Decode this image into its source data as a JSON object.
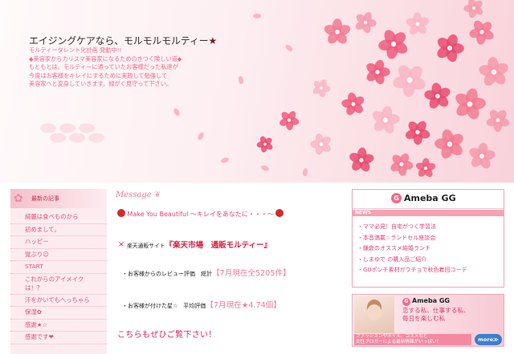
{
  "header": {
    "title": "エイジングケアなら、モルモルモルティー",
    "title_star": "★",
    "description": "モルティータレント化計画 発動中!!\n◆美容家からカリスマ美容家になるためのきつく険しい道◆\nもともとは、モルティーに通っていたお客様だった私達が\n今度はお客様をキレイにするために実践して勉強して\n美容家へと変身していきます。緑がく見守って下さい。"
  },
  "sidebar": {
    "title": "最新の記事",
    "items": [
      "綺麗は食べものから",
      "初めまして。",
      "ハッピー",
      "覚ぶり☺",
      "START",
      "これからのアイメイク\nは！？",
      "汗をかいてもへっちゃら",
      "保湿✿",
      "感謝★☆",
      "感謝です❤"
    ]
  },
  "main": {
    "message_title": "Message",
    "make_line": "Make You Beautiful ～キレイをあなたに・・・～",
    "rakuten_small": "楽天通販サイト",
    "rakuten_big": "『楽天市場　通販モルティー』",
    "review1_label": "・お客様からのレビュー評価　総計",
    "review1_value": "【7月現在全5205件】",
    "review2_label": "・お客様が付けた星☆　平均評価",
    "review2_value": "【7月現在★4.74個】",
    "look": "こちらもぜひご覧下さい！"
  },
  "right": {
    "logo": "Ameba GG",
    "logo_mark": "G",
    "news_label": "NEWS",
    "news": [
      "ママ必見！自宅がつく学習法",
      "本音満載☆ランドセル座談会",
      "鎌倉のオススメ結婚ランチ",
      "しまゆで の購入品ご紹介",
      "GUポンチ素材ガウチョで秋色着回コーデ"
    ]
  },
  "banner": {
    "logo": "Ameba GG",
    "logo_mark": "G",
    "copy": "恋する私、仕事する私、\n毎日を楽しむ私",
    "foot": "ファッションやネイル、コスメなど\n女性ブロガーによる最新情報がいっぱい！",
    "more": "more≫"
  },
  "colors": {
    "accent_pink": "#f06a8a",
    "text_pink": "#e0507a",
    "rakuten_red": "#e01a3a",
    "sidebar_bg": "#fcecef"
  }
}
